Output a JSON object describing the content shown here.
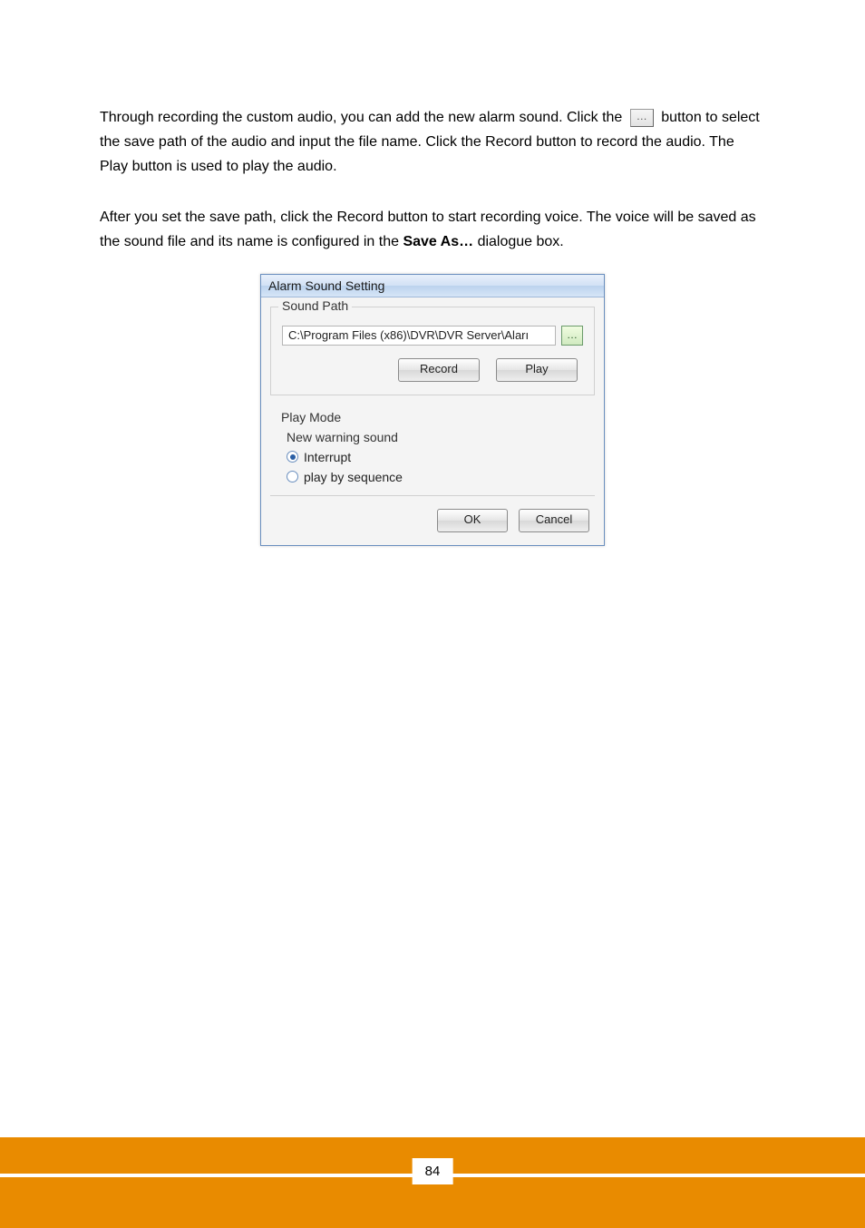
{
  "doc": {
    "para1_a": "Through recording the custom audio, you can add the new alarm sound. Click the ",
    "inline_browse": "…",
    "para1_b": " button to select the save path of the audio and input the file name. Click the Record button to record the audio. The Play button is used to play the audio.",
    "para2_a": "After you set the save path, click the Record button to start recording voice. The voice will be saved as the sound file and its name is configured in the ",
    "para2_bold": "Save As…",
    "para2_b": " dialogue box.",
    "page_number": "84"
  },
  "dialog": {
    "title": "Alarm Sound Setting",
    "sound_path": {
      "legend": "Sound Path",
      "path_value": "C:\\Program Files (x86)\\DVR\\DVR Server\\Aları",
      "browse_label": "…",
      "record_label": "Record",
      "play_label": "Play"
    },
    "play_mode": {
      "legend": "Play Mode",
      "subtitle": "New warning sound",
      "opt_interrupt": "Interrupt",
      "opt_sequence": "play by sequence",
      "selected": "interrupt"
    },
    "ok_label": "OK",
    "cancel_label": "Cancel"
  }
}
